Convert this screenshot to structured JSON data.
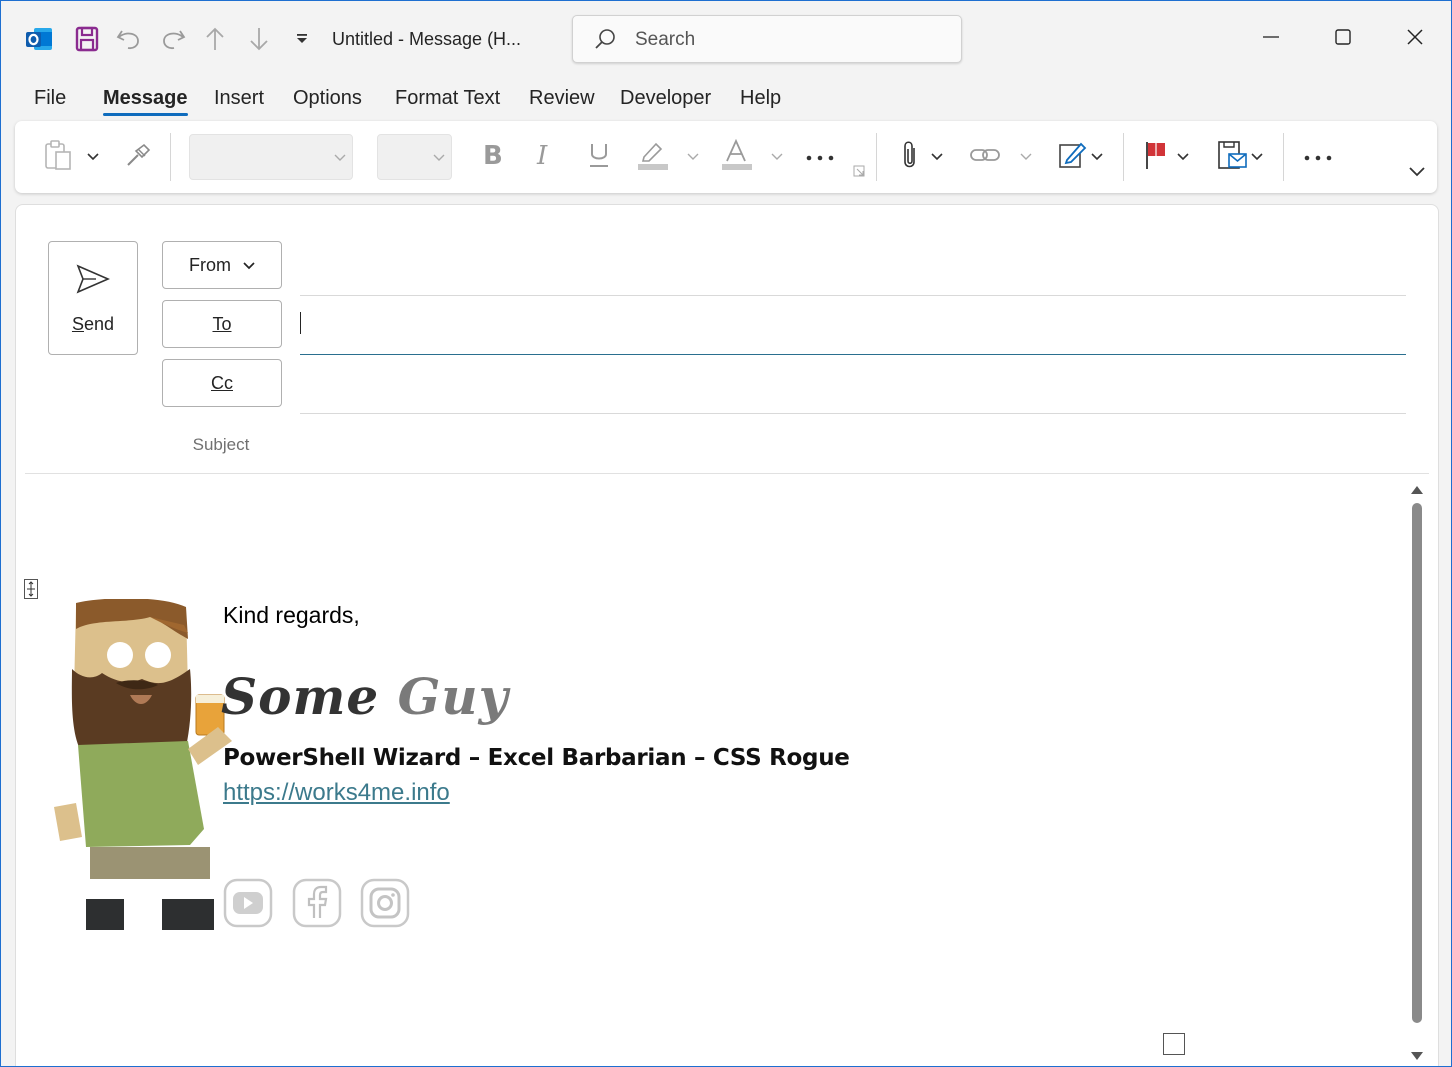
{
  "window": {
    "title": "Untitled  -  Message (H...",
    "search_placeholder": "Search"
  },
  "menu": {
    "tabs": [
      {
        "label": "File"
      },
      {
        "label": "Message"
      },
      {
        "label": "Insert"
      },
      {
        "label": "Options"
      },
      {
        "label": "Format Text"
      },
      {
        "label": "Review"
      },
      {
        "label": "Developer"
      },
      {
        "label": "Help"
      }
    ],
    "active_tab": "Message"
  },
  "compose": {
    "send_label": "Send",
    "from_label": "From",
    "to_label": "To",
    "cc_label": "Cc",
    "subject_label": "Subject",
    "to_value": "",
    "cc_value": "",
    "subject_value": ""
  },
  "body": {
    "greeting": "Kind regards,",
    "signature_name_first": "Some",
    "signature_name_last": "Guy",
    "signature_title": "PowerShell Wizard – Excel Barbarian – CSS Rogue",
    "signature_link": "https://works4me.info",
    "social_icons": [
      "youtube-icon",
      "facebook-icon",
      "instagram-icon"
    ]
  },
  "colors": {
    "accent": "#0f6cbd",
    "link": "#3c7a8c",
    "outlook_blue": "#0f6cbd",
    "save_purple": "#8a2b8f",
    "flag_red": "#d13438"
  }
}
